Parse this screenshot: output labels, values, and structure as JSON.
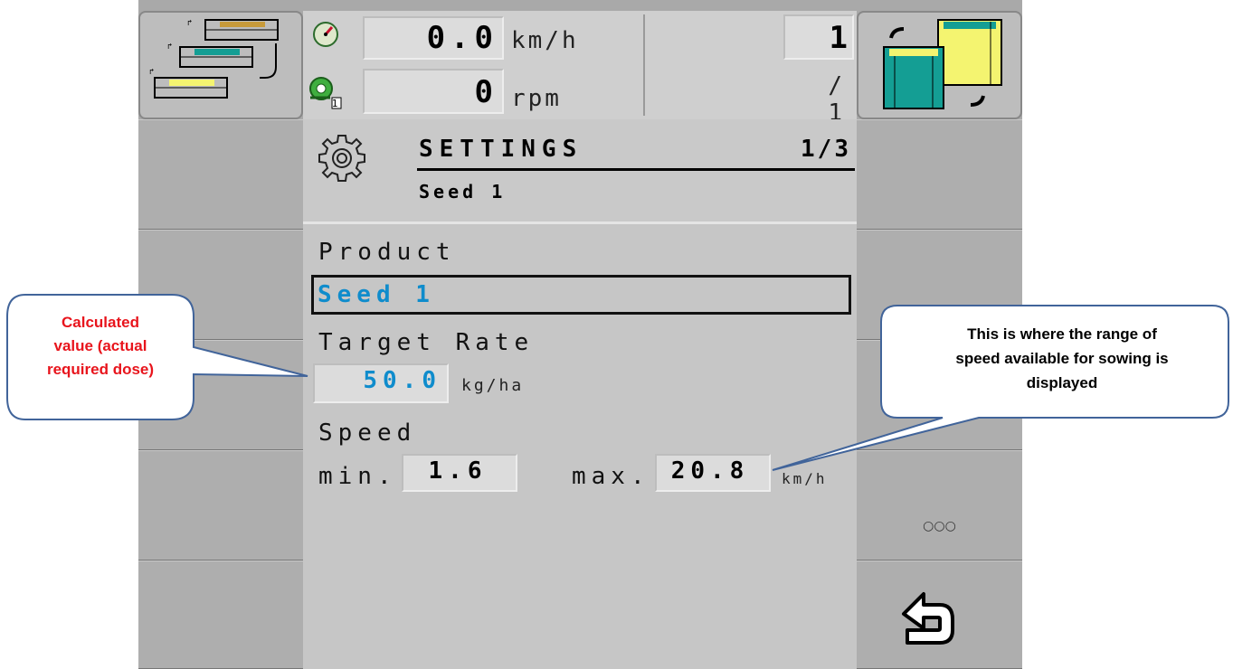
{
  "header": {
    "speed_value": "0.0",
    "speed_unit": "km/h",
    "rpm_value": "0",
    "rpm_unit": "rpm",
    "counter_value": "1",
    "counter_total": "/ 1",
    "rpm_index": "1"
  },
  "page": {
    "title": "SETTINGS",
    "page_indicator": "1/3",
    "subtitle": "Seed 1"
  },
  "form": {
    "product_label": "Product",
    "product_value": "Seed 1",
    "target_rate_label": "Target Rate",
    "target_rate_value": "50.0",
    "target_rate_unit": "kg/ha",
    "speed_label": "Speed",
    "min_label": "min.",
    "min_value": "1.6",
    "max_label": "max.",
    "max_value": "20.8",
    "speed_unit": "km/h"
  },
  "softkeys": {
    "more_label": "○○○"
  },
  "callouts": {
    "left": {
      "line1": "Calculated",
      "line2": "value (actual",
      "line3": "required dose)"
    },
    "right": {
      "line1": "This is where the range of",
      "line2": "speed available for sowing is",
      "line3": "displayed"
    }
  },
  "colors": {
    "accent_blue": "#0f8ccc",
    "teal": "#149e94",
    "yellow": "#f4f470",
    "gold": "#c79a3a",
    "callout_red": "#e8141c",
    "callout_border": "#41649a"
  }
}
